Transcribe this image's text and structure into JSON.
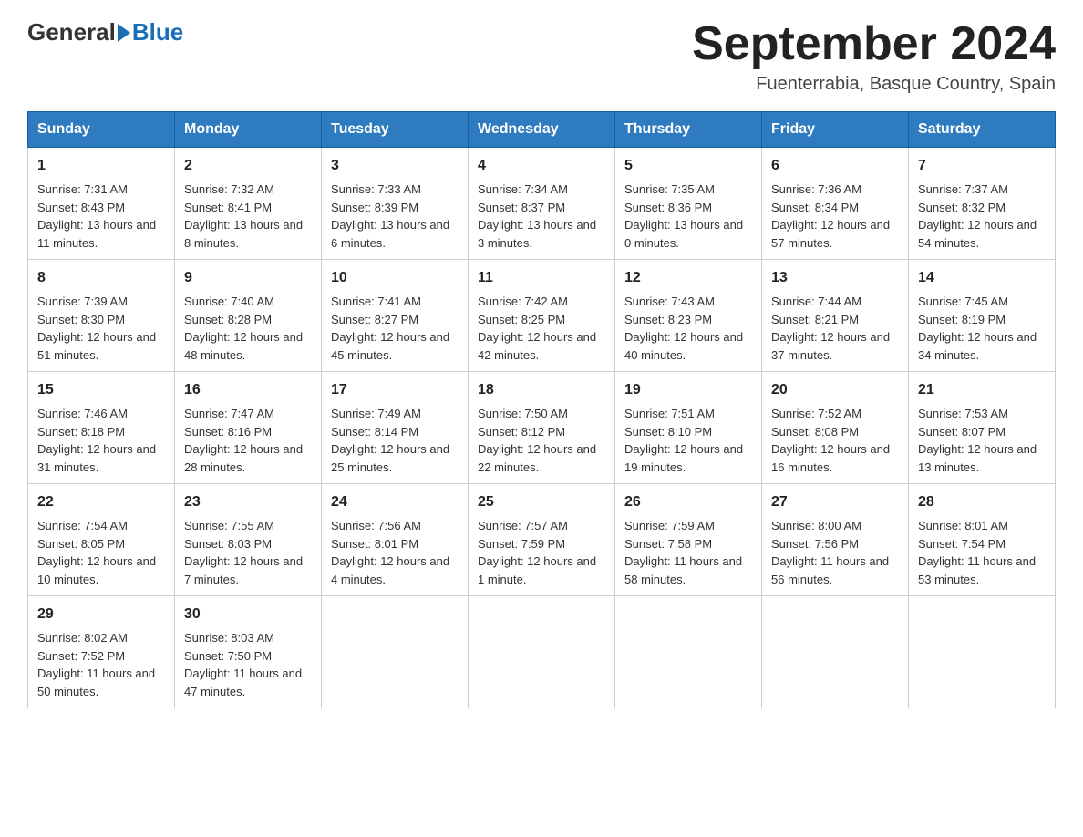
{
  "logo": {
    "general": "General",
    "blue": "Blue"
  },
  "title": "September 2024",
  "location": "Fuenterrabia, Basque Country, Spain",
  "headers": [
    "Sunday",
    "Monday",
    "Tuesday",
    "Wednesday",
    "Thursday",
    "Friday",
    "Saturday"
  ],
  "weeks": [
    [
      {
        "day": "1",
        "sunrise": "7:31 AM",
        "sunset": "8:43 PM",
        "daylight": "13 hours and 11 minutes."
      },
      {
        "day": "2",
        "sunrise": "7:32 AM",
        "sunset": "8:41 PM",
        "daylight": "13 hours and 8 minutes."
      },
      {
        "day": "3",
        "sunrise": "7:33 AM",
        "sunset": "8:39 PM",
        "daylight": "13 hours and 6 minutes."
      },
      {
        "day": "4",
        "sunrise": "7:34 AM",
        "sunset": "8:37 PM",
        "daylight": "13 hours and 3 minutes."
      },
      {
        "day": "5",
        "sunrise": "7:35 AM",
        "sunset": "8:36 PM",
        "daylight": "13 hours and 0 minutes."
      },
      {
        "day": "6",
        "sunrise": "7:36 AM",
        "sunset": "8:34 PM",
        "daylight": "12 hours and 57 minutes."
      },
      {
        "day": "7",
        "sunrise": "7:37 AM",
        "sunset": "8:32 PM",
        "daylight": "12 hours and 54 minutes."
      }
    ],
    [
      {
        "day": "8",
        "sunrise": "7:39 AM",
        "sunset": "8:30 PM",
        "daylight": "12 hours and 51 minutes."
      },
      {
        "day": "9",
        "sunrise": "7:40 AM",
        "sunset": "8:28 PM",
        "daylight": "12 hours and 48 minutes."
      },
      {
        "day": "10",
        "sunrise": "7:41 AM",
        "sunset": "8:27 PM",
        "daylight": "12 hours and 45 minutes."
      },
      {
        "day": "11",
        "sunrise": "7:42 AM",
        "sunset": "8:25 PM",
        "daylight": "12 hours and 42 minutes."
      },
      {
        "day": "12",
        "sunrise": "7:43 AM",
        "sunset": "8:23 PM",
        "daylight": "12 hours and 40 minutes."
      },
      {
        "day": "13",
        "sunrise": "7:44 AM",
        "sunset": "8:21 PM",
        "daylight": "12 hours and 37 minutes."
      },
      {
        "day": "14",
        "sunrise": "7:45 AM",
        "sunset": "8:19 PM",
        "daylight": "12 hours and 34 minutes."
      }
    ],
    [
      {
        "day": "15",
        "sunrise": "7:46 AM",
        "sunset": "8:18 PM",
        "daylight": "12 hours and 31 minutes."
      },
      {
        "day": "16",
        "sunrise": "7:47 AM",
        "sunset": "8:16 PM",
        "daylight": "12 hours and 28 minutes."
      },
      {
        "day": "17",
        "sunrise": "7:49 AM",
        "sunset": "8:14 PM",
        "daylight": "12 hours and 25 minutes."
      },
      {
        "day": "18",
        "sunrise": "7:50 AM",
        "sunset": "8:12 PM",
        "daylight": "12 hours and 22 minutes."
      },
      {
        "day": "19",
        "sunrise": "7:51 AM",
        "sunset": "8:10 PM",
        "daylight": "12 hours and 19 minutes."
      },
      {
        "day": "20",
        "sunrise": "7:52 AM",
        "sunset": "8:08 PM",
        "daylight": "12 hours and 16 minutes."
      },
      {
        "day": "21",
        "sunrise": "7:53 AM",
        "sunset": "8:07 PM",
        "daylight": "12 hours and 13 minutes."
      }
    ],
    [
      {
        "day": "22",
        "sunrise": "7:54 AM",
        "sunset": "8:05 PM",
        "daylight": "12 hours and 10 minutes."
      },
      {
        "day": "23",
        "sunrise": "7:55 AM",
        "sunset": "8:03 PM",
        "daylight": "12 hours and 7 minutes."
      },
      {
        "day": "24",
        "sunrise": "7:56 AM",
        "sunset": "8:01 PM",
        "daylight": "12 hours and 4 minutes."
      },
      {
        "day": "25",
        "sunrise": "7:57 AM",
        "sunset": "7:59 PM",
        "daylight": "12 hours and 1 minute."
      },
      {
        "day": "26",
        "sunrise": "7:59 AM",
        "sunset": "7:58 PM",
        "daylight": "11 hours and 58 minutes."
      },
      {
        "day": "27",
        "sunrise": "8:00 AM",
        "sunset": "7:56 PM",
        "daylight": "11 hours and 56 minutes."
      },
      {
        "day": "28",
        "sunrise": "8:01 AM",
        "sunset": "7:54 PM",
        "daylight": "11 hours and 53 minutes."
      }
    ],
    [
      {
        "day": "29",
        "sunrise": "8:02 AM",
        "sunset": "7:52 PM",
        "daylight": "11 hours and 50 minutes."
      },
      {
        "day": "30",
        "sunrise": "8:03 AM",
        "sunset": "7:50 PM",
        "daylight": "11 hours and 47 minutes."
      },
      null,
      null,
      null,
      null,
      null
    ]
  ]
}
